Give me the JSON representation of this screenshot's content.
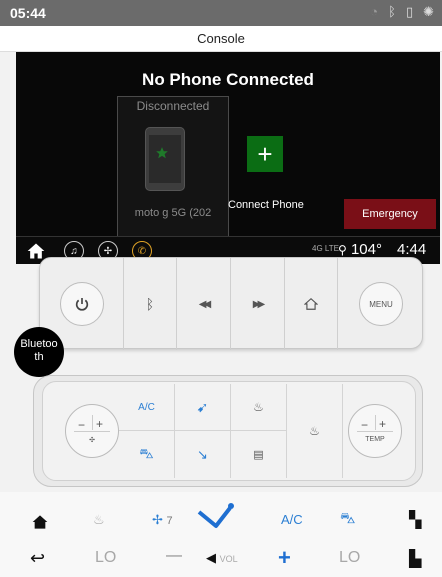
{
  "status_bar": {
    "time": "05:44"
  },
  "title_bar": {
    "title": "Console"
  },
  "head_unit": {
    "heading": "No Phone Connected",
    "phone_status": "Disconnected",
    "phone_name": "moto g 5G (202",
    "connect_label": "Connect Phone",
    "emergency_label": "Emergency",
    "network": "4G LTE",
    "temperature": "104°",
    "clock": "4:44"
  },
  "tooltip": {
    "text": "Bluetooth"
  },
  "panel": {
    "menu_label": "MENU"
  },
  "climate": {
    "ac_label": "A/C",
    "temp_label": "TEMP"
  },
  "bottom_bar": {
    "fan_level": "7",
    "ac_label": "A/C",
    "left_temp": "LO",
    "right_temp": "LO",
    "vol_label": "VOL",
    "minus": "—",
    "plus": "+"
  },
  "colors": {
    "accent": "#2c7fd3",
    "emergency": "#7a0f17",
    "add_phone": "#0b6d14"
  }
}
